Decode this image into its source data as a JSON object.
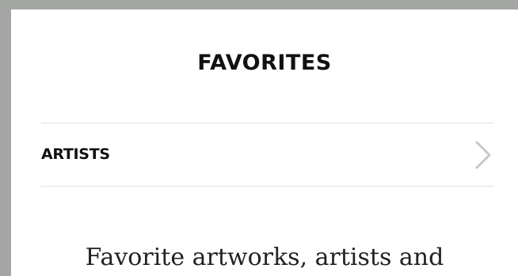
{
  "page": {
    "title": "FAVORITES",
    "list": [
      {
        "label": "ARTISTS",
        "icon": "chevron-right-icon"
      }
    ],
    "empty_message": "Favorite artworks, artists and"
  },
  "colors": {
    "background": "#a3a6a3",
    "panel": "#ffffff",
    "text": "#111111",
    "divider": "#e2e2e2",
    "chevron": "#c8c8c8"
  }
}
